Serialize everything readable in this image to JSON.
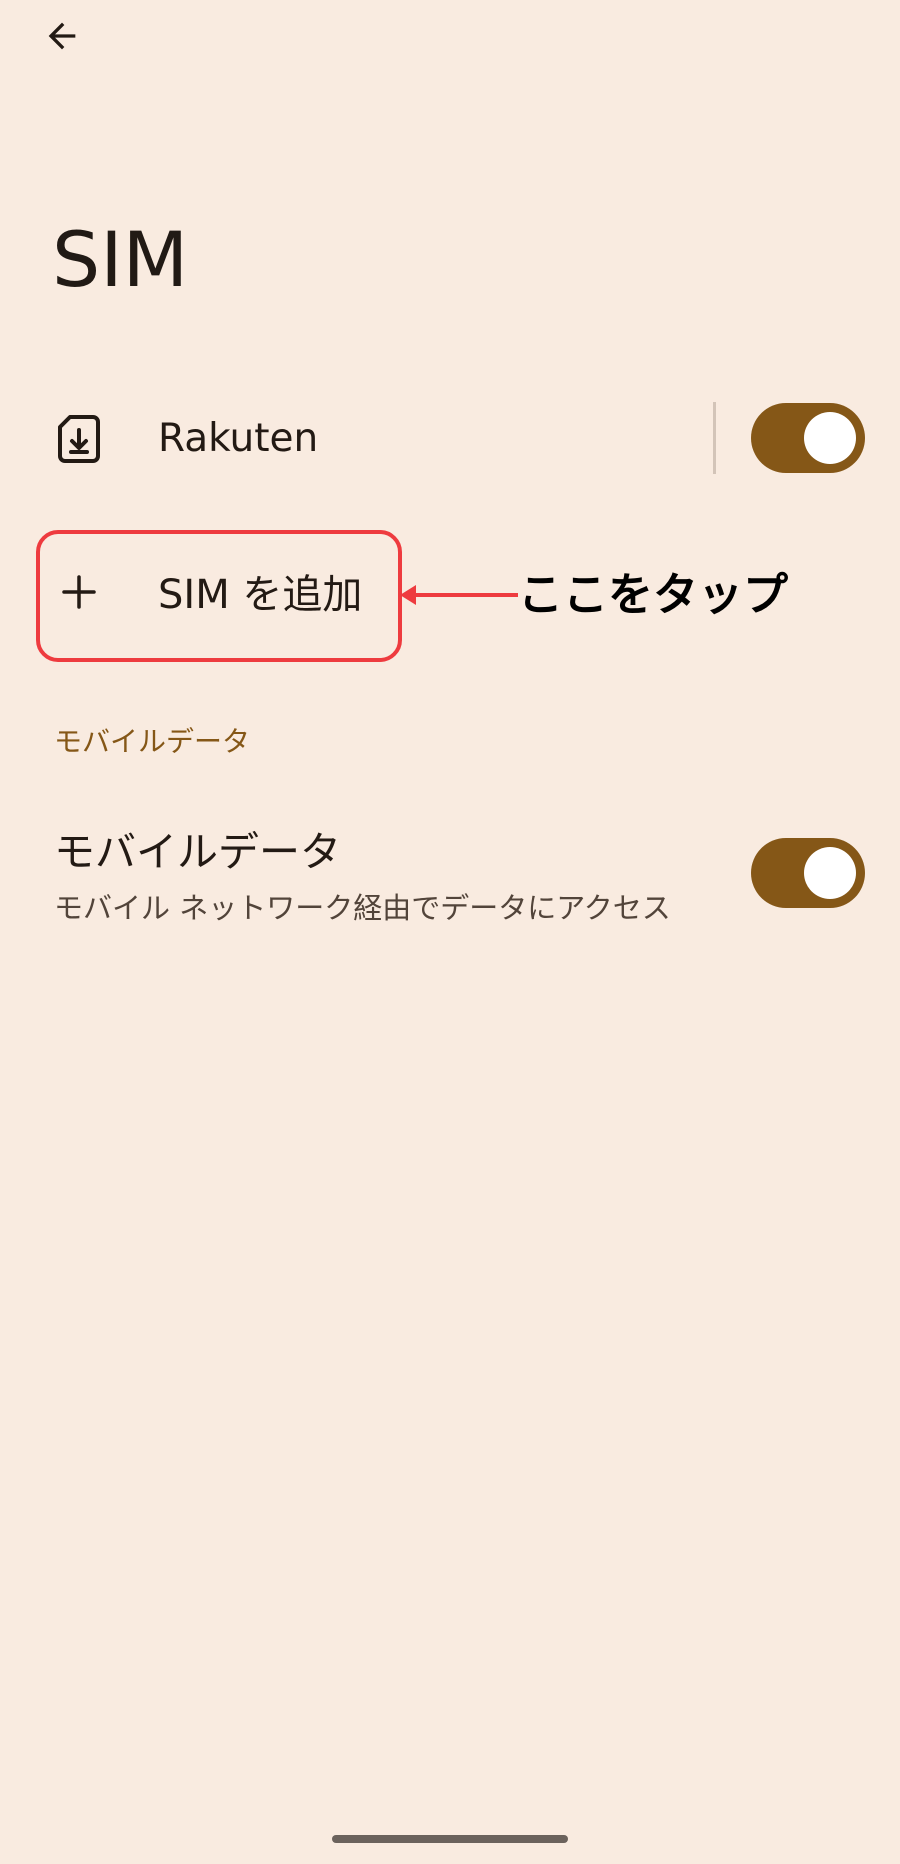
{
  "header": {
    "back_icon": "arrow-back-icon",
    "title": "SIM"
  },
  "sims": [
    {
      "icon": "sim-download-icon",
      "label": "Rakuten",
      "enabled": true
    }
  ],
  "add_sim": {
    "icon": "plus-icon",
    "label": "SIM を追加"
  },
  "annotation": {
    "text": "ここをタップ",
    "color": "#ee3b3f"
  },
  "mobile_data_section": {
    "header": "モバイルデータ",
    "item": {
      "title": "モバイルデータ",
      "subtitle": "モバイル ネットワーク経由でデータにアクセス",
      "enabled": true
    }
  },
  "colors": {
    "background": "#f9ebe0",
    "accent": "#855717",
    "highlight": "#ee3b3f"
  }
}
